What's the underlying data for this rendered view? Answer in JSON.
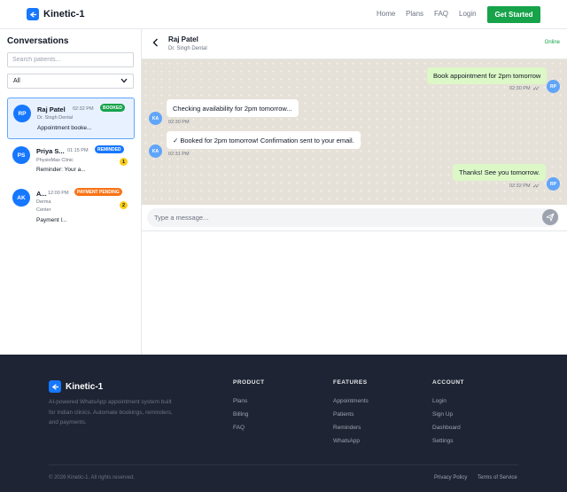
{
  "navbar": {
    "brand": "Kinetic-1",
    "links": [
      "Home",
      "Plans",
      "FAQ",
      "Login"
    ],
    "cta": "Get Started"
  },
  "sidebar": {
    "title": "Conversations",
    "search_placeholder": "Search patients...",
    "filter_value": "All",
    "conversations": [
      {
        "initials": "RP",
        "name": "Raj Patel",
        "time": "02:32 PM",
        "badge": "BOOKED",
        "badge_color": "#16a34a",
        "clinic": "Dr. Singh Dental",
        "preview": "Appointment booke...",
        "unread": ""
      },
      {
        "initials": "PS",
        "name": "Priya S...",
        "time": "01:15 PM",
        "badge": "REMINDED",
        "badge_color": "#1677ff",
        "clinic": "PhysioMax Clinic",
        "preview": "Reminder: Your a...",
        "unread": "1"
      },
      {
        "initials": "AK",
        "name": "A...",
        "time": "12:00 PM",
        "badge": "PAYMENT PENDING",
        "badge_color": "#f97316",
        "clinic_line1": "Derma",
        "clinic_line2": "Center",
        "preview": "Payment l...",
        "unread": "2"
      }
    ]
  },
  "chat": {
    "name": "Raj Patel",
    "subtitle": "Dr. Singh Dental",
    "status": "Online",
    "messages": [
      {
        "direction": "out",
        "text": "Book appointment for 2pm tomorrow",
        "time": "02:30 PM",
        "avatar": "RP"
      },
      {
        "direction": "in",
        "text": "Checking availability for 2pm tomorrow...",
        "time": "02:30 PM",
        "avatar": "KA"
      },
      {
        "direction": "in",
        "text": "✓ Booked for 2pm tomorrow! Confirmation sent to your email.",
        "time": "02:31 PM",
        "avatar": "KA"
      },
      {
        "direction": "out",
        "text": "Thanks! See you tomorrow.",
        "time": "02:32 PM",
        "avatar": "RP"
      }
    ],
    "compose_placeholder": "Type a message..."
  },
  "footer": {
    "brand": "Kinetic-1",
    "description": "AI-powered WhatsApp appointment system built for Indian clinics. Automate bookings, reminders, and payments.",
    "columns": [
      {
        "title": "PRODUCT",
        "links": [
          "Plans",
          "Billing",
          "FAQ"
        ]
      },
      {
        "title": "FEATURES",
        "links": [
          "Appointments",
          "Patients",
          "Reminders",
          "WhatsApp"
        ]
      },
      {
        "title": "ACCOUNT",
        "links": [
          "Login",
          "Sign Up",
          "Dashboard",
          "Settings"
        ]
      }
    ],
    "copyright": "© 2026 Kinetic-1. All rights reserved.",
    "legal": [
      "Privacy Policy",
      "Terms of Service"
    ]
  },
  "colors": {
    "brand_blue": "#1677ff",
    "cta_green": "#16a34a",
    "footer_bg": "#1e2433",
    "chat_bg": "#e6e1d8",
    "outgoing_bubble": "#dcf8c6"
  },
  "icons": {
    "brand": "login-arrow-icon",
    "back": "chevron-left-icon",
    "send": "send-icon",
    "read_receipt": "double-check-icon"
  }
}
